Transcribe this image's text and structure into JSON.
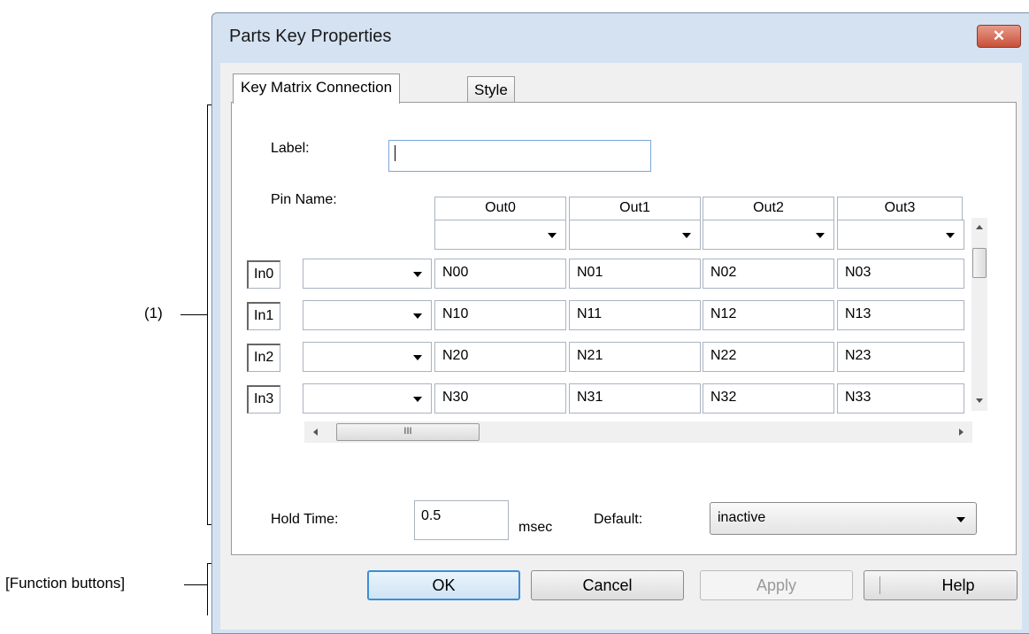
{
  "annotations": {
    "area1": "(1)",
    "function_buttons": "[Function buttons]"
  },
  "window": {
    "title": "Parts Key Properties",
    "close_glyph": "✕"
  },
  "tabs": [
    {
      "label": "Key Matrix Connection",
      "active": true
    },
    {
      "label": "Style",
      "active": false
    }
  ],
  "form": {
    "label_caption": "Label:",
    "label_value": "",
    "pin_name_caption": "Pin Name:",
    "out_headers": [
      "Out0",
      "Out1",
      "Out2",
      "Out3"
    ],
    "in_labels": [
      "In0",
      "In1",
      "In2",
      "In3"
    ],
    "cells": [
      [
        "N00",
        "N01",
        "N02",
        "N03"
      ],
      [
        "N10",
        "N11",
        "N12",
        "N13"
      ],
      [
        "N20",
        "N21",
        "N22",
        "N23"
      ],
      [
        "N30",
        "N31",
        "N32",
        "N33"
      ]
    ],
    "hscroll_grip": "III",
    "hold_time_caption": "Hold Time:",
    "hold_time_value": "0.5",
    "hold_time_unit": "msec",
    "default_caption": "Default:",
    "default_value": "inactive"
  },
  "buttons": {
    "ok": "OK",
    "cancel": "Cancel",
    "apply": "Apply",
    "help": "Help"
  }
}
